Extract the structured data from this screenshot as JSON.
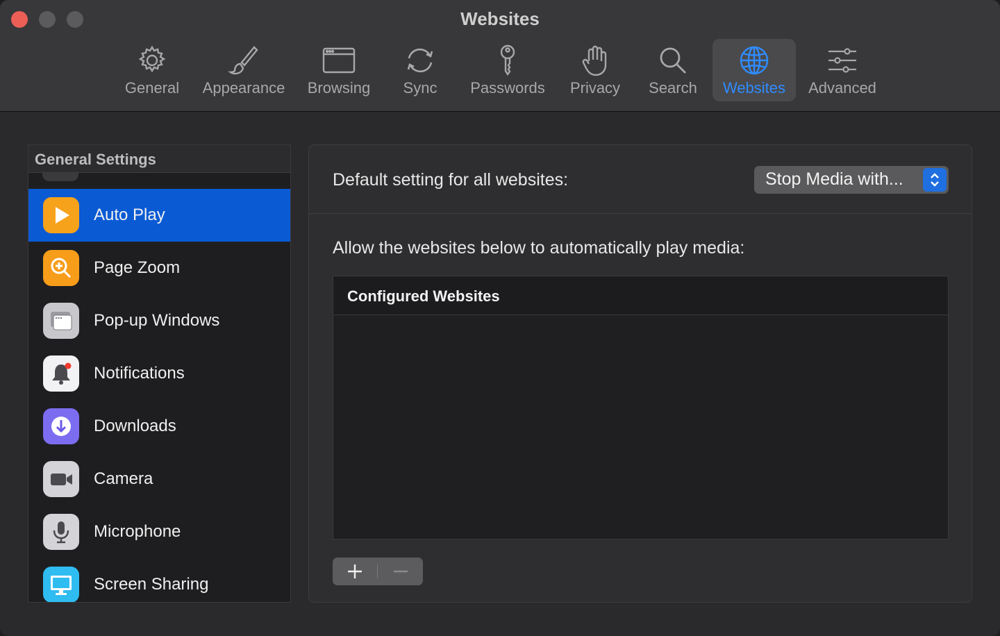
{
  "window": {
    "title": "Websites"
  },
  "toolbar": {
    "tabs": [
      {
        "label": "General",
        "icon": "gear-icon"
      },
      {
        "label": "Appearance",
        "icon": "paintbrush-icon"
      },
      {
        "label": "Browsing",
        "icon": "browser-window-icon"
      },
      {
        "label": "Sync",
        "icon": "sync-icon"
      },
      {
        "label": "Passwords",
        "icon": "key-icon"
      },
      {
        "label": "Privacy",
        "icon": "hand-icon"
      },
      {
        "label": "Search",
        "icon": "magnifier-icon"
      },
      {
        "label": "Websites",
        "icon": "globe-icon",
        "active": true
      },
      {
        "label": "Advanced",
        "icon": "sliders-icon"
      }
    ]
  },
  "sidebar": {
    "header": "General Settings",
    "items": [
      {
        "label": "Auto Play",
        "icon": "play-icon",
        "selected": true
      },
      {
        "label": "Page Zoom",
        "icon": "zoom-icon"
      },
      {
        "label": "Pop-up Windows",
        "icon": "popup-window-icon"
      },
      {
        "label": "Notifications",
        "icon": "bell-icon"
      },
      {
        "label": "Downloads",
        "icon": "download-icon"
      },
      {
        "label": "Camera",
        "icon": "camera-icon"
      },
      {
        "label": "Microphone",
        "icon": "microphone-icon"
      },
      {
        "label": "Screen Sharing",
        "icon": "monitor-icon"
      }
    ]
  },
  "main": {
    "default_label": "Default setting for all websites:",
    "default_select_value": "Stop Media with...",
    "allow_label": "Allow the websites below to automatically play media:",
    "table_header": "Configured Websites"
  },
  "colors": {
    "accent": "#2f8cff",
    "selection": "#0a5ad4",
    "close": "#ec5f57"
  }
}
